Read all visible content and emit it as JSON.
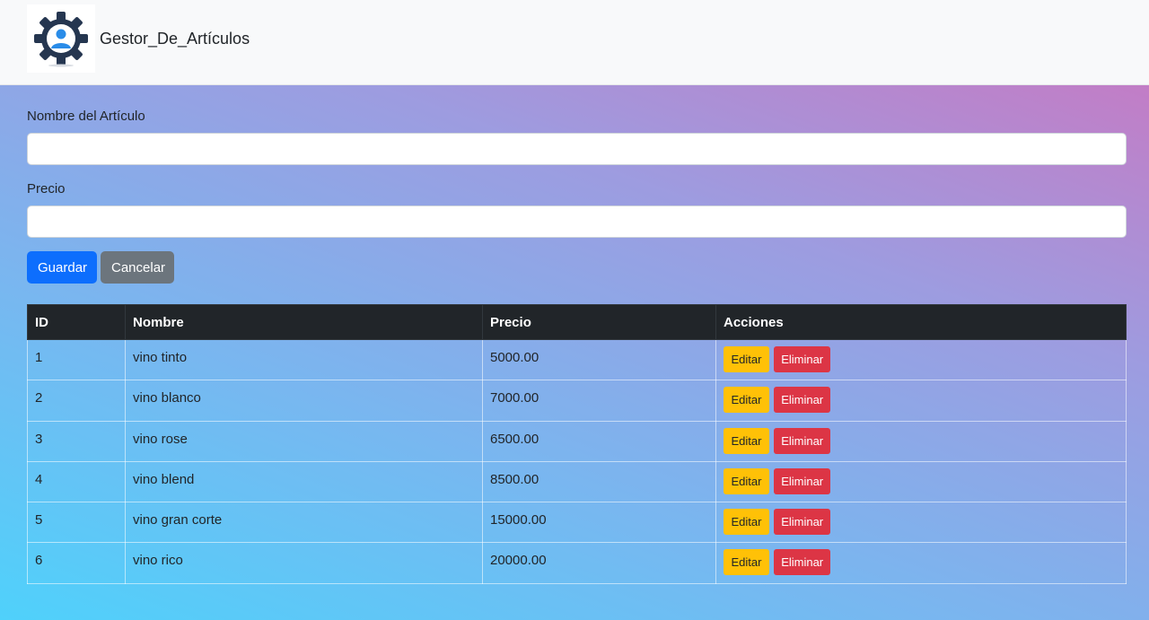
{
  "navbar": {
    "brand": "Gestor_De_Artículos",
    "logo_icon": "gear-user-icon"
  },
  "form": {
    "name_label": "Nombre del Artículo",
    "name_value": "",
    "price_label": "Precio",
    "price_value": "",
    "save_label": "Guardar",
    "cancel_label": "Cancelar"
  },
  "table": {
    "headers": [
      "ID",
      "Nombre",
      "Precio",
      "Acciones"
    ],
    "edit_label": "Editar",
    "delete_label": "Eliminar",
    "rows": [
      {
        "id": "1",
        "nombre": "vino tinto",
        "precio": "5000.00"
      },
      {
        "id": "2",
        "nombre": "vino blanco",
        "precio": "7000.00"
      },
      {
        "id": "3",
        "nombre": "vino rose",
        "precio": "6500.00"
      },
      {
        "id": "4",
        "nombre": "vino blend",
        "precio": "8500.00"
      },
      {
        "id": "5",
        "nombre": "vino gran corte",
        "precio": "15000.00"
      },
      {
        "id": "6",
        "nombre": "vino rico",
        "precio": "20000.00"
      }
    ]
  },
  "colors": {
    "primary": "#0d6efd",
    "secondary": "#6c757d",
    "warning": "#ffc107",
    "danger": "#dc3545",
    "table_header": "#212529",
    "logo_dark": "#253650",
    "logo_blue": "#2a8ce8"
  }
}
